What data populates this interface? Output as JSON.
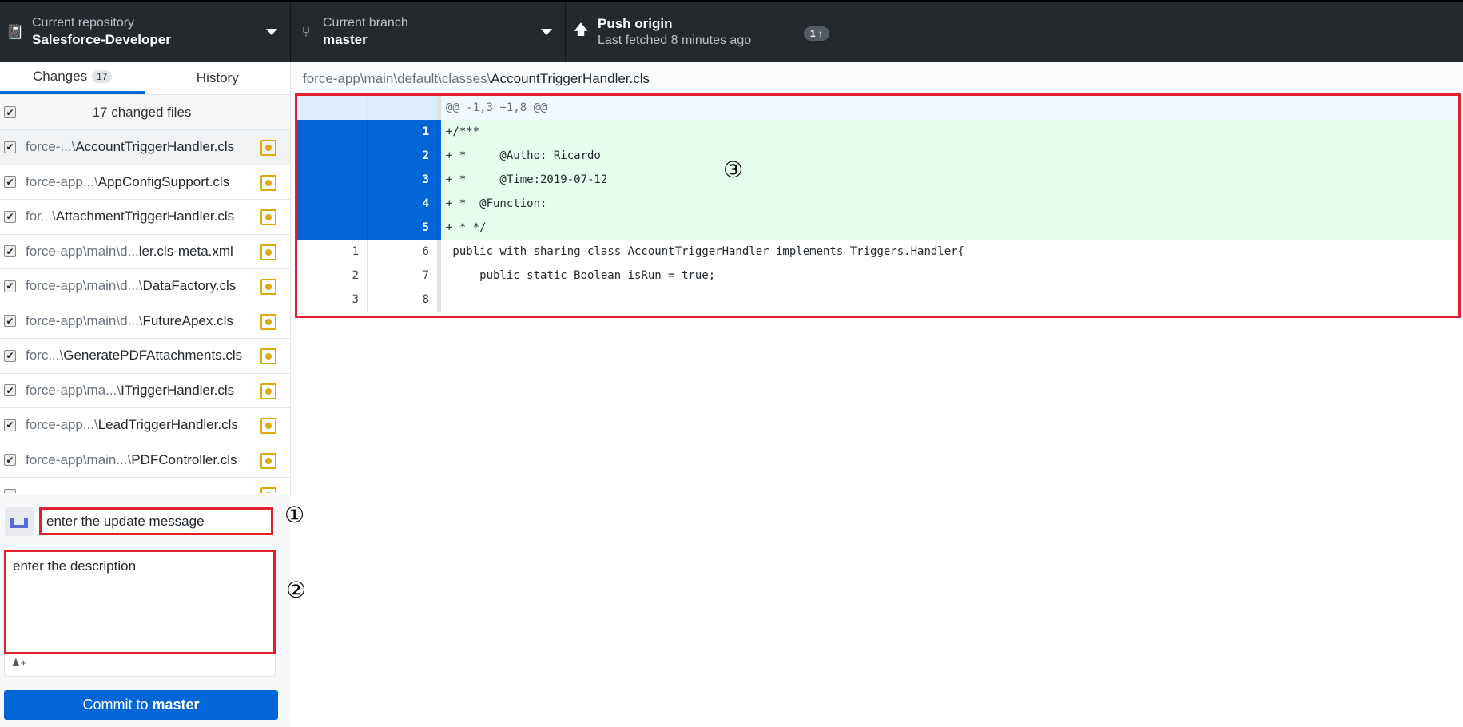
{
  "header": {
    "repo_label": "Current repository",
    "repo_value": "Salesforce-Developer",
    "branch_label": "Current branch",
    "branch_value": "master",
    "push_label": "Push origin",
    "push_sub": "Last fetched 8 minutes ago",
    "push_badge": "1 ↑"
  },
  "tabs": {
    "changes": "Changes",
    "changes_count": "17",
    "history": "History"
  },
  "changed_files_label": "17 changed files",
  "files": [
    {
      "path": "force-...\\",
      "name": "AccountTriggerHandler.cls"
    },
    {
      "path": "force-app...\\",
      "name": "AppConfigSupport.cls"
    },
    {
      "path": "for...\\",
      "name": "AttachmentTriggerHandler.cls"
    },
    {
      "path": "force-app\\main\\d...",
      "name": "ler.cls-meta.xml"
    },
    {
      "path": "force-app\\main\\d...\\",
      "name": "DataFactory.cls"
    },
    {
      "path": "force-app\\main\\d...\\",
      "name": "FutureApex.cls"
    },
    {
      "path": "forc...\\",
      "name": "GeneratePDFAttachments.cls"
    },
    {
      "path": "force-app\\ma...\\",
      "name": "ITriggerHandler.cls"
    },
    {
      "path": "force-app...\\",
      "name": "LeadTriggerHandler.cls"
    },
    {
      "path": "force-app\\main...\\",
      "name": "PDFController.cls"
    }
  ],
  "commit": {
    "summary": "enter the update message",
    "description": "enter the description",
    "coauthor_icon": "♟+",
    "button_prefix": "Commit to ",
    "button_branch": "master"
  },
  "annotations": {
    "one": "①",
    "two": "②",
    "three": "③"
  },
  "diff": {
    "path_dir": "force-app\\main\\default\\classes\\",
    "path_file": "AccountTriggerHandler.cls",
    "lines": [
      {
        "type": "hunk",
        "old": "",
        "new": "",
        "text": "@@ -1,3 +1,8 @@"
      },
      {
        "type": "add",
        "old": "",
        "new": "1",
        "text": "+/***"
      },
      {
        "type": "add",
        "old": "",
        "new": "2",
        "text": "+ *     @Autho: Ricardo"
      },
      {
        "type": "add",
        "old": "",
        "new": "3",
        "text": "+ *     @Time:2019-07-12"
      },
      {
        "type": "add",
        "old": "",
        "new": "4",
        "text": "+ *  @Function:"
      },
      {
        "type": "add",
        "old": "",
        "new": "5",
        "text": "+ * */"
      },
      {
        "type": "ctx",
        "old": "1",
        "new": "6",
        "text": " public with sharing class AccountTriggerHandler implements Triggers.Handler{"
      },
      {
        "type": "ctx",
        "old": "2",
        "new": "7",
        "text": "     public static Boolean isRun = true;"
      },
      {
        "type": "ctx",
        "old": "3",
        "new": "8",
        "text": ""
      }
    ]
  },
  "colors": {
    "header_bg": "#24292e",
    "accent": "#0366d6",
    "added_bg": "#e6ffed",
    "modified": "#dbab09",
    "annotation_box": "#e0202c"
  }
}
